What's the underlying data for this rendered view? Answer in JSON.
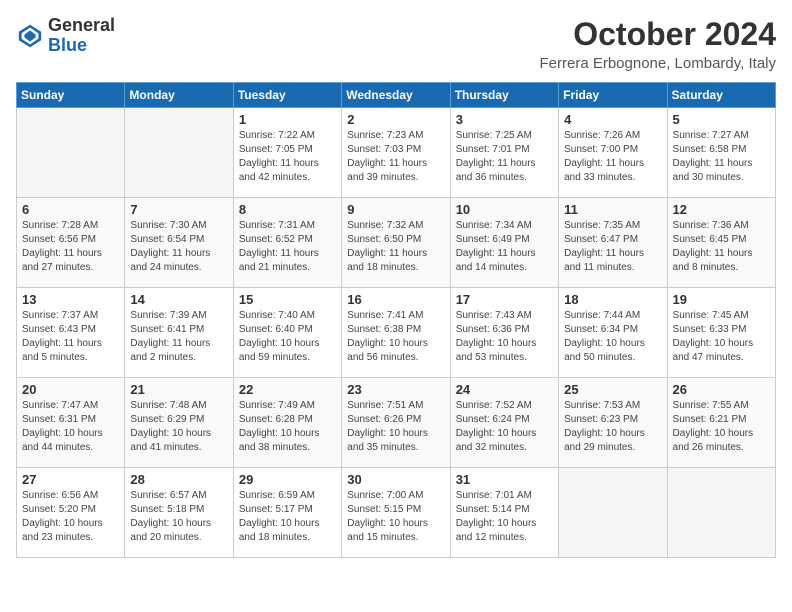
{
  "logo": {
    "general": "General",
    "blue": "Blue"
  },
  "header": {
    "month": "October 2024",
    "location": "Ferrera Erbognone, Lombardy, Italy"
  },
  "weekdays": [
    "Sunday",
    "Monday",
    "Tuesday",
    "Wednesday",
    "Thursday",
    "Friday",
    "Saturday"
  ],
  "weeks": [
    [
      {
        "day": "",
        "sunrise": "",
        "sunset": "",
        "daylight": ""
      },
      {
        "day": "",
        "sunrise": "",
        "sunset": "",
        "daylight": ""
      },
      {
        "day": "1",
        "sunrise": "Sunrise: 7:22 AM",
        "sunset": "Sunset: 7:05 PM",
        "daylight": "Daylight: 11 hours and 42 minutes."
      },
      {
        "day": "2",
        "sunrise": "Sunrise: 7:23 AM",
        "sunset": "Sunset: 7:03 PM",
        "daylight": "Daylight: 11 hours and 39 minutes."
      },
      {
        "day": "3",
        "sunrise": "Sunrise: 7:25 AM",
        "sunset": "Sunset: 7:01 PM",
        "daylight": "Daylight: 11 hours and 36 minutes."
      },
      {
        "day": "4",
        "sunrise": "Sunrise: 7:26 AM",
        "sunset": "Sunset: 7:00 PM",
        "daylight": "Daylight: 11 hours and 33 minutes."
      },
      {
        "day": "5",
        "sunrise": "Sunrise: 7:27 AM",
        "sunset": "Sunset: 6:58 PM",
        "daylight": "Daylight: 11 hours and 30 minutes."
      }
    ],
    [
      {
        "day": "6",
        "sunrise": "Sunrise: 7:28 AM",
        "sunset": "Sunset: 6:56 PM",
        "daylight": "Daylight: 11 hours and 27 minutes."
      },
      {
        "day": "7",
        "sunrise": "Sunrise: 7:30 AM",
        "sunset": "Sunset: 6:54 PM",
        "daylight": "Daylight: 11 hours and 24 minutes."
      },
      {
        "day": "8",
        "sunrise": "Sunrise: 7:31 AM",
        "sunset": "Sunset: 6:52 PM",
        "daylight": "Daylight: 11 hours and 21 minutes."
      },
      {
        "day": "9",
        "sunrise": "Sunrise: 7:32 AM",
        "sunset": "Sunset: 6:50 PM",
        "daylight": "Daylight: 11 hours and 18 minutes."
      },
      {
        "day": "10",
        "sunrise": "Sunrise: 7:34 AM",
        "sunset": "Sunset: 6:49 PM",
        "daylight": "Daylight: 11 hours and 14 minutes."
      },
      {
        "day": "11",
        "sunrise": "Sunrise: 7:35 AM",
        "sunset": "Sunset: 6:47 PM",
        "daylight": "Daylight: 11 hours and 11 minutes."
      },
      {
        "day": "12",
        "sunrise": "Sunrise: 7:36 AM",
        "sunset": "Sunset: 6:45 PM",
        "daylight": "Daylight: 11 hours and 8 minutes."
      }
    ],
    [
      {
        "day": "13",
        "sunrise": "Sunrise: 7:37 AM",
        "sunset": "Sunset: 6:43 PM",
        "daylight": "Daylight: 11 hours and 5 minutes."
      },
      {
        "day": "14",
        "sunrise": "Sunrise: 7:39 AM",
        "sunset": "Sunset: 6:41 PM",
        "daylight": "Daylight: 11 hours and 2 minutes."
      },
      {
        "day": "15",
        "sunrise": "Sunrise: 7:40 AM",
        "sunset": "Sunset: 6:40 PM",
        "daylight": "Daylight: 10 hours and 59 minutes."
      },
      {
        "day": "16",
        "sunrise": "Sunrise: 7:41 AM",
        "sunset": "Sunset: 6:38 PM",
        "daylight": "Daylight: 10 hours and 56 minutes."
      },
      {
        "day": "17",
        "sunrise": "Sunrise: 7:43 AM",
        "sunset": "Sunset: 6:36 PM",
        "daylight": "Daylight: 10 hours and 53 minutes."
      },
      {
        "day": "18",
        "sunrise": "Sunrise: 7:44 AM",
        "sunset": "Sunset: 6:34 PM",
        "daylight": "Daylight: 10 hours and 50 minutes."
      },
      {
        "day": "19",
        "sunrise": "Sunrise: 7:45 AM",
        "sunset": "Sunset: 6:33 PM",
        "daylight": "Daylight: 10 hours and 47 minutes."
      }
    ],
    [
      {
        "day": "20",
        "sunrise": "Sunrise: 7:47 AM",
        "sunset": "Sunset: 6:31 PM",
        "daylight": "Daylight: 10 hours and 44 minutes."
      },
      {
        "day": "21",
        "sunrise": "Sunrise: 7:48 AM",
        "sunset": "Sunset: 6:29 PM",
        "daylight": "Daylight: 10 hours and 41 minutes."
      },
      {
        "day": "22",
        "sunrise": "Sunrise: 7:49 AM",
        "sunset": "Sunset: 6:28 PM",
        "daylight": "Daylight: 10 hours and 38 minutes."
      },
      {
        "day": "23",
        "sunrise": "Sunrise: 7:51 AM",
        "sunset": "Sunset: 6:26 PM",
        "daylight": "Daylight: 10 hours and 35 minutes."
      },
      {
        "day": "24",
        "sunrise": "Sunrise: 7:52 AM",
        "sunset": "Sunset: 6:24 PM",
        "daylight": "Daylight: 10 hours and 32 minutes."
      },
      {
        "day": "25",
        "sunrise": "Sunrise: 7:53 AM",
        "sunset": "Sunset: 6:23 PM",
        "daylight": "Daylight: 10 hours and 29 minutes."
      },
      {
        "day": "26",
        "sunrise": "Sunrise: 7:55 AM",
        "sunset": "Sunset: 6:21 PM",
        "daylight": "Daylight: 10 hours and 26 minutes."
      }
    ],
    [
      {
        "day": "27",
        "sunrise": "Sunrise: 6:56 AM",
        "sunset": "Sunset: 5:20 PM",
        "daylight": "Daylight: 10 hours and 23 minutes."
      },
      {
        "day": "28",
        "sunrise": "Sunrise: 6:57 AM",
        "sunset": "Sunset: 5:18 PM",
        "daylight": "Daylight: 10 hours and 20 minutes."
      },
      {
        "day": "29",
        "sunrise": "Sunrise: 6:59 AM",
        "sunset": "Sunset: 5:17 PM",
        "daylight": "Daylight: 10 hours and 18 minutes."
      },
      {
        "day": "30",
        "sunrise": "Sunrise: 7:00 AM",
        "sunset": "Sunset: 5:15 PM",
        "daylight": "Daylight: 10 hours and 15 minutes."
      },
      {
        "day": "31",
        "sunrise": "Sunrise: 7:01 AM",
        "sunset": "Sunset: 5:14 PM",
        "daylight": "Daylight: 10 hours and 12 minutes."
      },
      {
        "day": "",
        "sunrise": "",
        "sunset": "",
        "daylight": ""
      },
      {
        "day": "",
        "sunrise": "",
        "sunset": "",
        "daylight": ""
      }
    ]
  ]
}
